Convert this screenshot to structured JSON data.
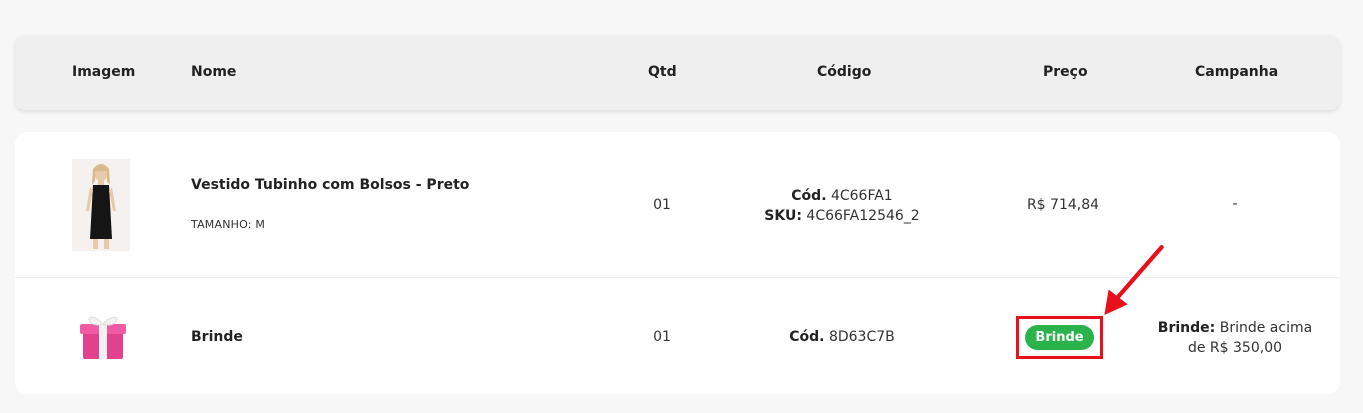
{
  "table": {
    "headers": {
      "image": "Imagem",
      "name": "Nome",
      "qty": "Qtd",
      "code": "Código",
      "price": "Preço",
      "campaign": "Campanha"
    },
    "rows": [
      {
        "name": "Vestido Tubinho com Bolsos - Preto",
        "variant": "TAMANHO: M",
        "qty": "01",
        "code_label": "Cód.",
        "code_value": "4C66FA1",
        "sku_label": "SKU:",
        "sku_value": "4C66FA12546_2",
        "price": "R$ 714,84",
        "campaign": "-",
        "image_icon": "dress-photo"
      },
      {
        "name": "Brinde",
        "qty": "01",
        "code_label": "Cód.",
        "code_value": "8D63C7B",
        "price_badge": "Brinde",
        "campaign_label": "Brinde:",
        "campaign_line1": "Brinde acima",
        "campaign_line2": "de R$ 350,00",
        "image_icon": "gift-box-icon"
      }
    ]
  },
  "annotation": {
    "highlight_color": "#e8101a",
    "arrow_icon": "red-arrow-icon"
  },
  "colors": {
    "badge_green": "#29b34a",
    "background": "#f7f7f7",
    "header_bg": "#efefef"
  }
}
